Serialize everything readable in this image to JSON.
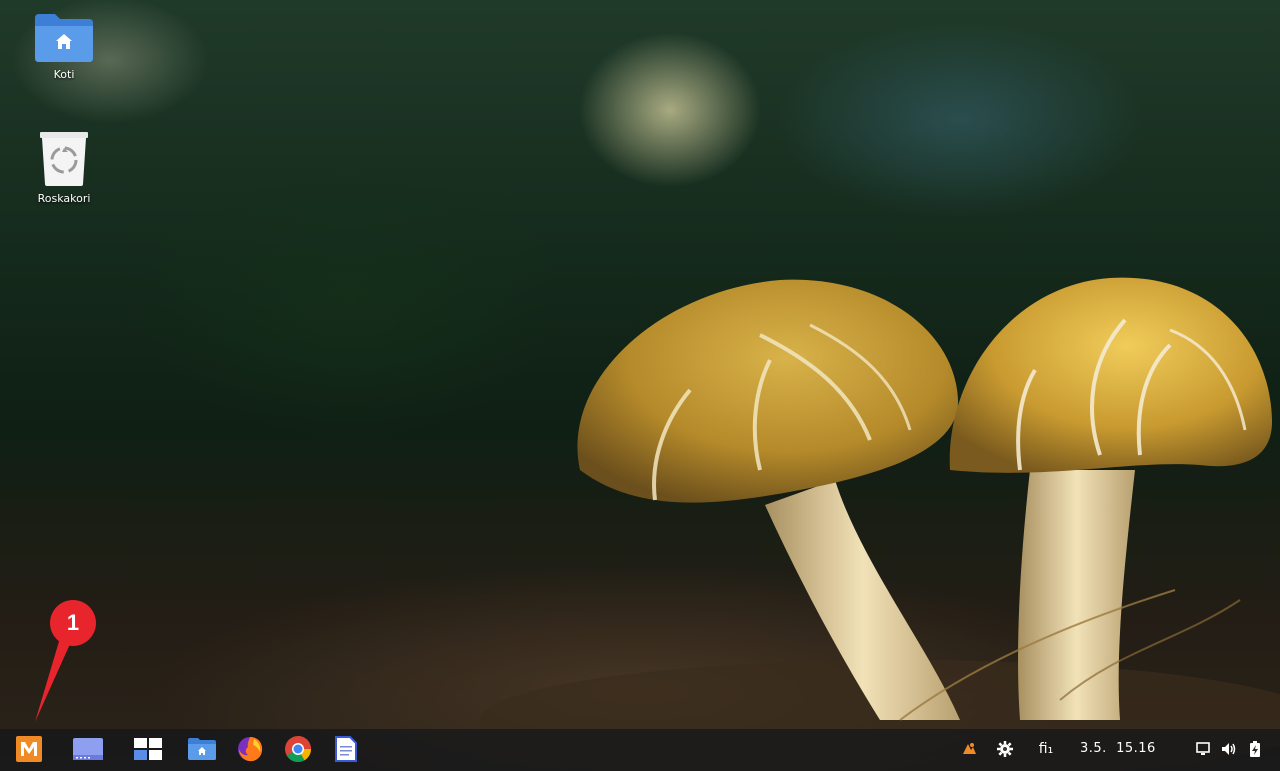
{
  "desktop": {
    "icons": [
      {
        "label": "Koti",
        "icon": "home-folder-icon"
      },
      {
        "label": "Roskakori",
        "icon": "trash-icon"
      }
    ]
  },
  "annotation": {
    "number": "1",
    "color": "#e8242c"
  },
  "taskbar": {
    "launchers": [
      {
        "name": "menu",
        "icon": "app-menu-icon"
      },
      {
        "name": "desktop",
        "icon": "show-desktop-icon"
      },
      {
        "name": "workspaces",
        "icon": "workspace-switcher-icon"
      },
      {
        "name": "files",
        "icon": "file-manager-icon"
      },
      {
        "name": "firefox",
        "icon": "firefox-icon"
      },
      {
        "name": "chrome",
        "icon": "chrome-icon"
      },
      {
        "name": "text-editor",
        "icon": "text-editor-icon"
      }
    ],
    "tray": {
      "language": "fi₁",
      "clock": "3.5.  15.16"
    }
  },
  "colors": {
    "accent_orange": "#f08a24",
    "folder_blue": "#4a90e2",
    "taskbar_bg": "#14161a"
  }
}
